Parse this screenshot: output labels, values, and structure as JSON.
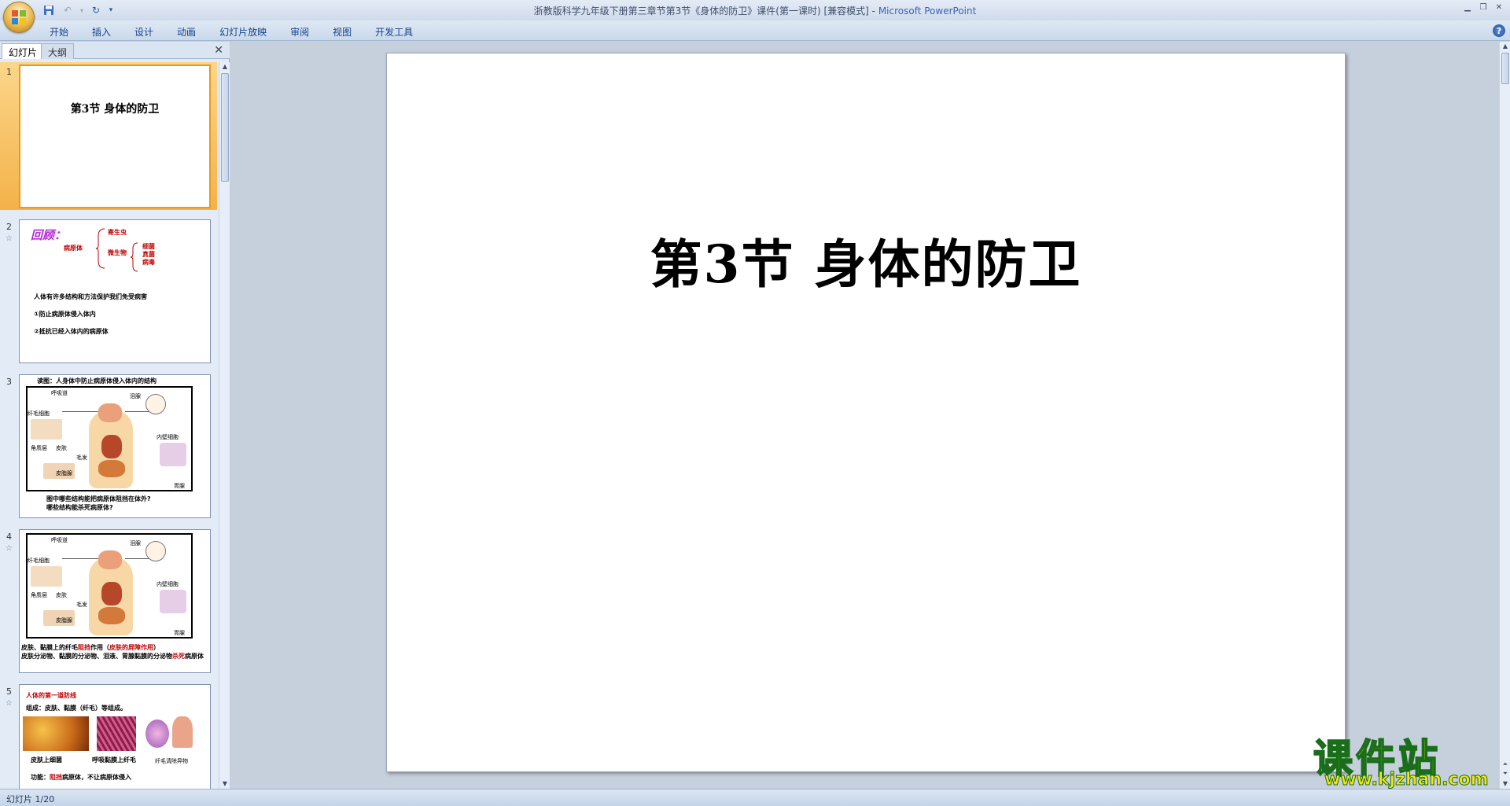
{
  "window": {
    "title": "浙教版科学九年级下册第三章节第3节《身体的防卫》课件(第一课时) [兼容模式]",
    "separator": " - ",
    "app_name": "Microsoft PowerPoint"
  },
  "ribbon": {
    "tabs": [
      "开始",
      "插入",
      "设计",
      "动画",
      "幻灯片放映",
      "审阅",
      "视图",
      "开发工具"
    ]
  },
  "left_pane": {
    "tabs": [
      "幻灯片",
      "大纲"
    ],
    "slides": [
      {
        "number": "1",
        "title": "第3节  身体的防卫"
      },
      {
        "number": "2",
        "review": "回顾：",
        "pathogen": "病原体",
        "parasite": "寄生虫",
        "microbe": "微生物",
        "bacteria": "细菌",
        "fungi": "真菌",
        "virus": "病毒",
        "line1": "人体有许多结构和方法保护我们免受病害",
        "line2": "①防止病原体侵入体内",
        "line3": "②抵抗已经入体内的病原体"
      },
      {
        "number": "3",
        "header": "读图：人身体中防止病原体侵入体内的结构",
        "labels": [
          "呼吸道",
          "泪腺",
          "纤毛细胞",
          "角质层",
          "皮肤",
          "毛发",
          "皮脂腺",
          "内壁细胞",
          "胃腺"
        ],
        "q1": "图中哪些结构能把病原体阻挡在体外?",
        "q2": "哪些结构能杀死病原体?"
      },
      {
        "number": "4",
        "labels": [
          "呼吸道",
          "泪腺",
          "纤毛细胞",
          "角质层",
          "皮肤",
          "毛发",
          "皮脂腺",
          "内壁细胞",
          "胃腺"
        ],
        "c1a": "皮肤、黏膜上的纤毛",
        "c1b": "阻挡",
        "c1c": "作用（",
        "c1d": "皮肤的屏障作用",
        "c1e": "）",
        "c2a": "皮肤分泌物、黏膜的分泌物、泪液、胃腺黏膜的分泌物",
        "c2b": "杀死",
        "c2c": "病原体"
      },
      {
        "number": "5",
        "header": "人体的第一道防线",
        "compose": "组成：皮肤、黏膜（纤毛）等组成。",
        "cap1": "皮肤上细菌",
        "cap2": "呼吸黏膜上纤毛",
        "cap3": "纤毛清除异物",
        "func_a": "功能：",
        "func_b": "阻挡",
        "func_c": "病原体，不让病原体侵入"
      }
    ]
  },
  "slide": {
    "title": "第3节  身体的防卫"
  },
  "watermark": {
    "text": "课件站",
    "url": "www.kjzhan.com"
  },
  "status": {
    "text": "幻灯片 1/20"
  },
  "colors": {
    "accent": "#15428b",
    "selection": "#f4b248",
    "slide_bg": "#ffffff",
    "workspace": "#c6cfdc"
  }
}
